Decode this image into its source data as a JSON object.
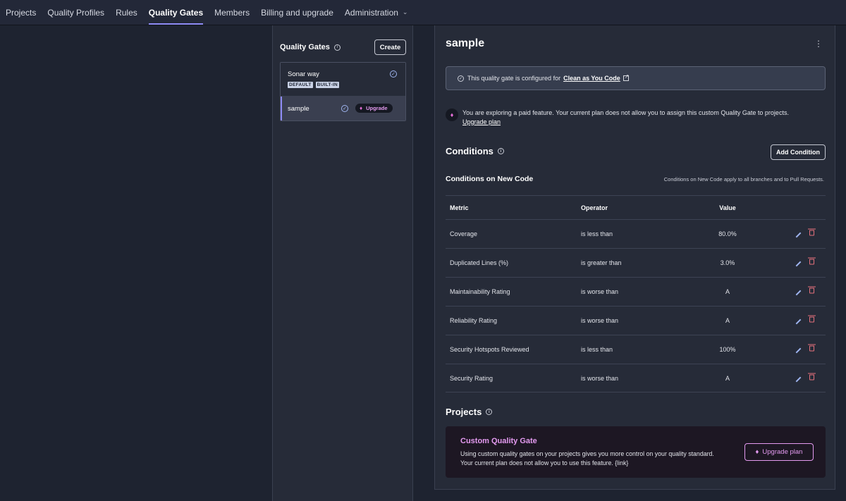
{
  "nav": {
    "items": [
      {
        "label": "Projects"
      },
      {
        "label": "Quality Profiles"
      },
      {
        "label": "Rules"
      },
      {
        "label": "Quality Gates",
        "active": true
      },
      {
        "label": "Members"
      },
      {
        "label": "Billing and upgrade"
      },
      {
        "label": "Administration",
        "dropdown": true
      }
    ]
  },
  "gates_panel": {
    "title": "Quality Gates",
    "create_label": "Create",
    "gates": [
      {
        "name": "Sonar way",
        "tags": [
          "DEFAULT",
          "BUILT-IN"
        ],
        "icon": "check-circle-icon"
      },
      {
        "name": "sample",
        "badge": "Upgrade",
        "icon": "check-circle-icon",
        "selected": true
      }
    ]
  },
  "detail": {
    "title": "sample",
    "banner_text": "This quality gate is configured for",
    "banner_link": "Clean as You Code",
    "paid_text": "You are exploring a paid feature. Your current plan does not allow you to assign this custom Quality Gate to projects.",
    "paid_link": "Upgrade plan",
    "conditions_title": "Conditions",
    "add_condition_label": "Add Condition",
    "new_code_title": "Conditions on New Code",
    "new_code_note": "Conditions on New Code apply to all branches and to Pull Requests.",
    "table": {
      "headers": {
        "metric": "Metric",
        "operator": "Operator",
        "value": "Value"
      },
      "rows": [
        {
          "metric": "Coverage",
          "operator": "is less than",
          "value": "80.0%"
        },
        {
          "metric": "Duplicated Lines (%)",
          "operator": "is greater than",
          "value": "3.0%"
        },
        {
          "metric": "Maintainability Rating",
          "operator": "is worse than",
          "value": "A"
        },
        {
          "metric": "Reliability Rating",
          "operator": "is worse than",
          "value": "A"
        },
        {
          "metric": "Security Hotspots Reviewed",
          "operator": "is less than",
          "value": "100%"
        },
        {
          "metric": "Security Rating",
          "operator": "is worse than",
          "value": "A"
        }
      ]
    },
    "projects_title": "Projects",
    "upsell": {
      "title": "Custom Quality Gate",
      "body_line1": "Using custom quality gates on your projects gives you more control on your quality standard.",
      "body_line2": "Your current plan does not allow you to use this feature. {link}",
      "button_label": "Upgrade plan"
    }
  },
  "colors": {
    "accent": "#8e8bf5",
    "upgrade_pink": "#e49af0",
    "delete_red": "#e5707b",
    "edit_blue": "#9fb5f0"
  }
}
